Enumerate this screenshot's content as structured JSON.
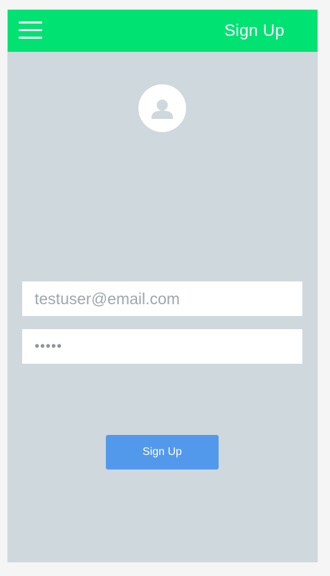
{
  "header": {
    "title": "Sign Up",
    "menu_icon": "hamburger-menu-icon"
  },
  "avatar": {
    "icon": "user-icon"
  },
  "form": {
    "email_value": "testuser@email.com",
    "password_value": "•••••"
  },
  "actions": {
    "signup_label": "Sign Up"
  },
  "colors": {
    "header_bg": "#00e272",
    "screen_bg": "#cfd8dd",
    "button_bg": "#5299ec",
    "text_muted": "#9ea7ad"
  }
}
